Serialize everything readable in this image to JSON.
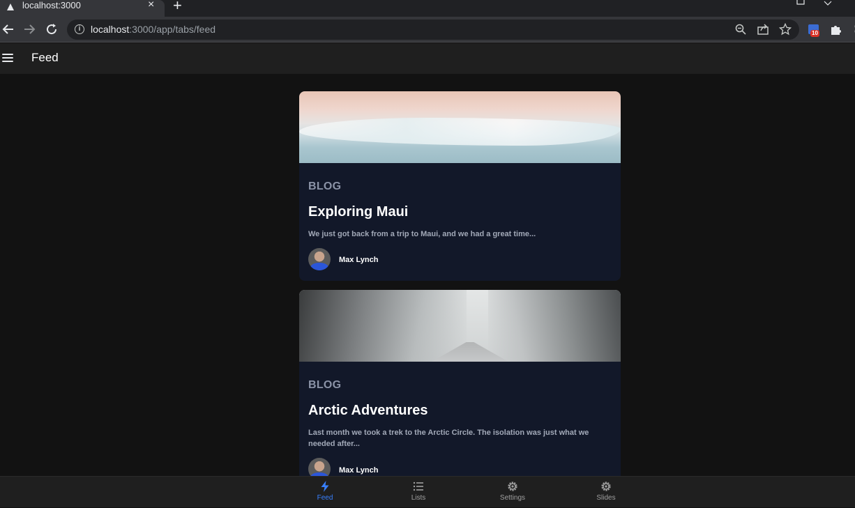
{
  "browser": {
    "tab_title": "localhost:3000",
    "tab_close": "×",
    "new_tab": "+",
    "url_host": "localhost",
    "url_rest": ":3000/app/tabs/feed",
    "extension_badge": "10"
  },
  "app": {
    "title": "Feed"
  },
  "cards": [
    {
      "subtitle": "BLOG",
      "title": "Exploring Maui",
      "description": "We just got back from a trip to Maui, and we had a great time...",
      "author": "Max Lynch"
    },
    {
      "subtitle": "BLOG",
      "title": "Arctic Adventures",
      "description": "Last month we took a trek to the Arctic Circle. The isolation was just what we needed after...",
      "author": "Max Lynch"
    }
  ],
  "tabs": [
    {
      "label": "Feed",
      "icon": "flash-icon",
      "active": true
    },
    {
      "label": "Lists",
      "icon": "list-icon",
      "active": false
    },
    {
      "label": "Settings",
      "icon": "cog-icon",
      "active": false
    },
    {
      "label": "Slides",
      "icon": "cog-icon",
      "active": false
    }
  ],
  "colors": {
    "accent": "#3880ff",
    "card_bg": "#121829",
    "page_bg": "#121212"
  }
}
